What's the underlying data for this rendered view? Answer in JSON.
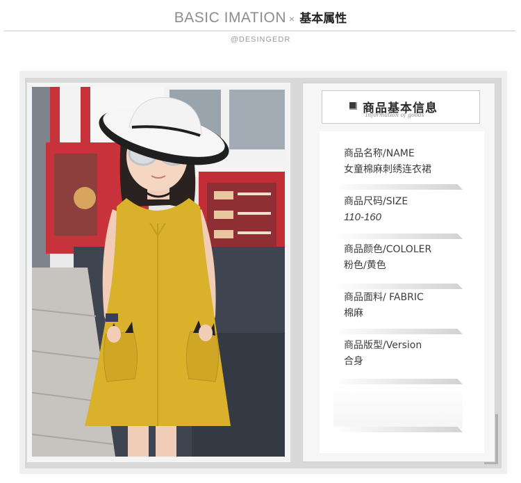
{
  "header": {
    "title_en": "BASIC IMATION",
    "title_sep": "×",
    "title_cn": "基本属性",
    "subtitle": "@DESINGEDR"
  },
  "info": {
    "title_cn": "商品基本信息",
    "title_script": "Information of goods",
    "rows": [
      {
        "label": "商品名称/NAME",
        "value": "女童棉麻刺绣连衣裙"
      },
      {
        "label": "商品尺码/SIZE",
        "value": "110-160"
      },
      {
        "label": "商品颜色/COLOLER",
        "value": "粉色/黄色"
      },
      {
        "label": "商品面料/ FABRIC",
        "value": "棉麻"
      },
      {
        "label": "商品版型/Version",
        "value": "合身"
      }
    ]
  },
  "colors": {
    "dress": "#d9b12a",
    "panel_bg": "#f6f6f6",
    "frame_bg": "#d8d8d8",
    "storefront_red": "#c8323a"
  },
  "icons": {
    "title_marker": "square-bullet-icon"
  }
}
